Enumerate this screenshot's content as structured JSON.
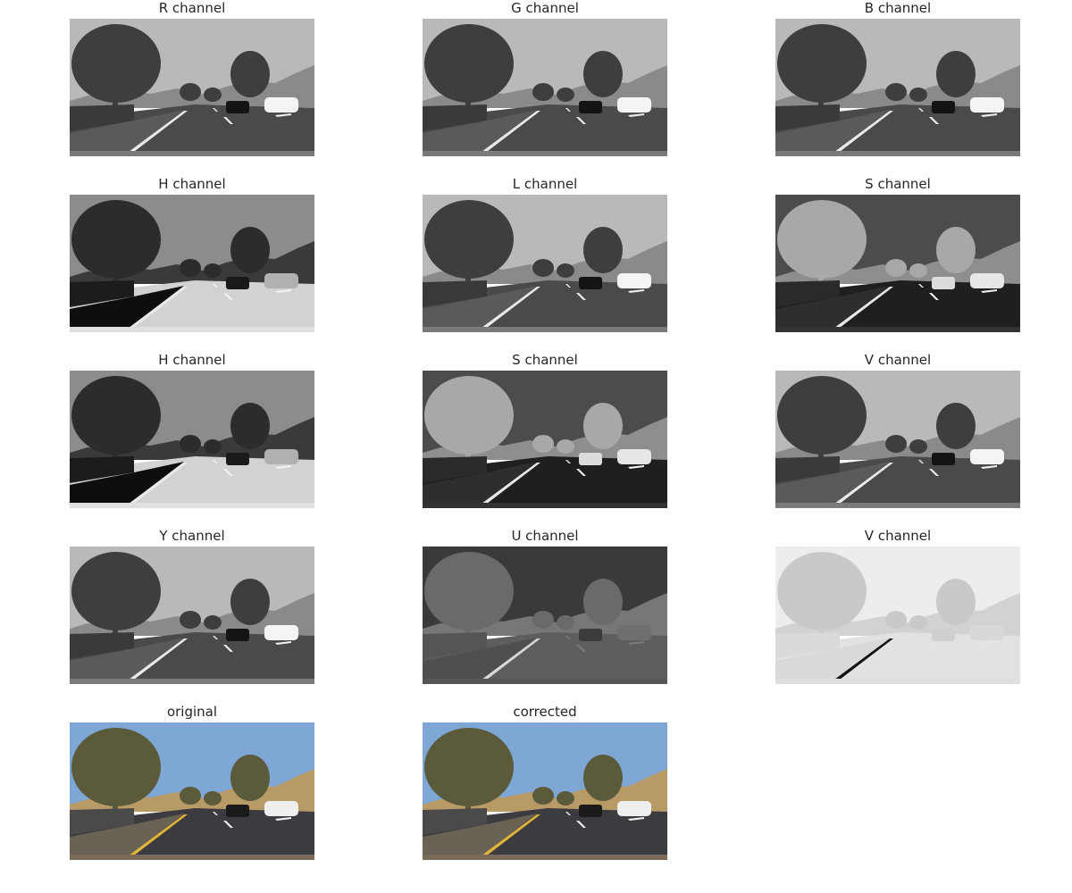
{
  "figure": {
    "panels": [
      {
        "title": "R channel",
        "kind": "gray",
        "tone": "normal"
      },
      {
        "title": "G channel",
        "kind": "gray",
        "tone": "normal"
      },
      {
        "title": "B channel",
        "kind": "gray",
        "tone": "normal"
      },
      {
        "title": "H channel",
        "kind": "hue",
        "tone": "hue"
      },
      {
        "title": "L channel",
        "kind": "gray",
        "tone": "normal"
      },
      {
        "title": "S channel",
        "kind": "sat",
        "tone": "sat"
      },
      {
        "title": "H channel",
        "kind": "hue",
        "tone": "hue"
      },
      {
        "title": "S channel",
        "kind": "sat",
        "tone": "sat"
      },
      {
        "title": "V channel",
        "kind": "gray",
        "tone": "normal"
      },
      {
        "title": "Y channel",
        "kind": "gray",
        "tone": "normal"
      },
      {
        "title": "U channel",
        "kind": "chroma-u",
        "tone": "dark"
      },
      {
        "title": "V channel",
        "kind": "chroma-v",
        "tone": "light"
      },
      {
        "title": "original",
        "kind": "color",
        "tone": "color"
      },
      {
        "title": "corrected",
        "kind": "color",
        "tone": "color"
      }
    ]
  },
  "colors": {
    "title_text": "#262626",
    "sky": "#7ea7d6",
    "foliage": "#5b5a3a",
    "road": "#3b3b40",
    "lane_yellow": "#e0b53a",
    "lane_white": "#f2f2f2",
    "hill": "#b79a66"
  }
}
